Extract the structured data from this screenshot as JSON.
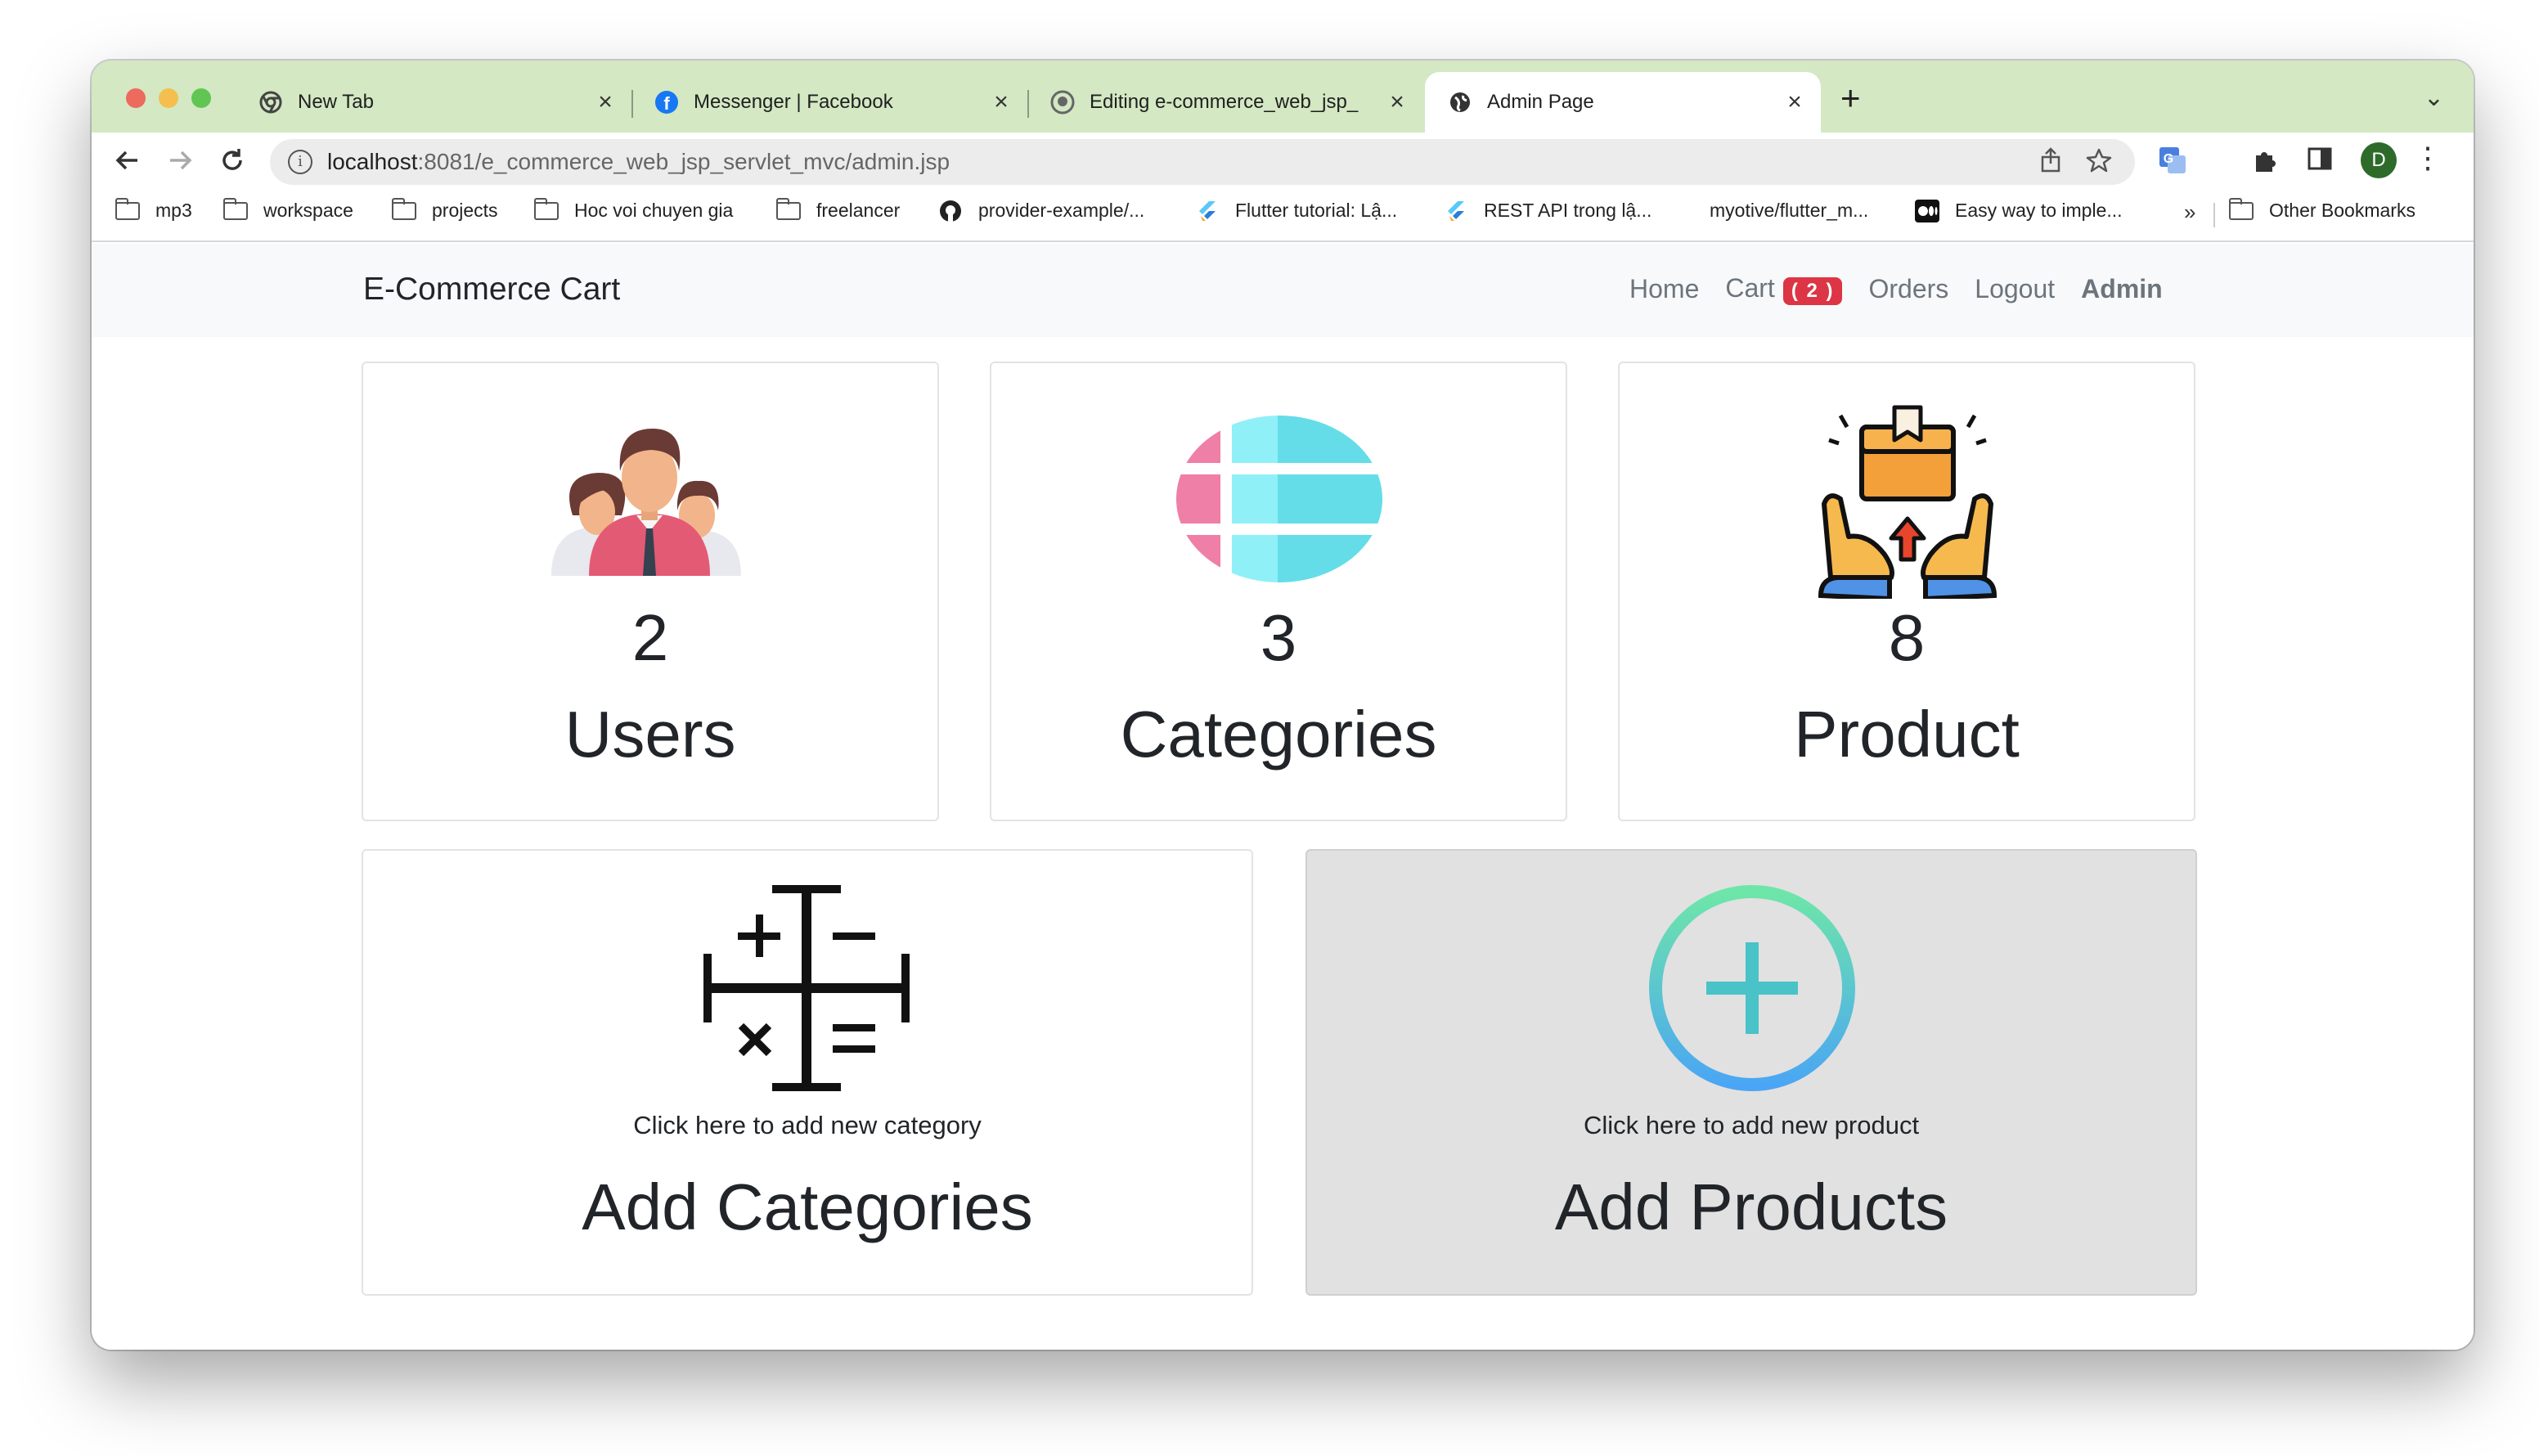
{
  "browser": {
    "tabs": [
      {
        "title": "New Tab",
        "icon": "chrome-icon"
      },
      {
        "title": "Messenger | Facebook",
        "icon": "facebook-icon"
      },
      {
        "title": "Editing e-commerce_web_jsp_",
        "icon": "github-icon"
      },
      {
        "title": "Admin Page",
        "icon": "globe-icon"
      }
    ],
    "url_host": "localhost",
    "url_path": ":8081/e_commerce_web_jsp_servlet_mvc/admin.jsp",
    "profile_initial": "D",
    "bookmarks": [
      {
        "label": "mp3",
        "icon": "folder-icon"
      },
      {
        "label": "workspace",
        "icon": "folder-icon"
      },
      {
        "label": "projects",
        "icon": "folder-icon"
      },
      {
        "label": "Hoc voi chuyen gia",
        "icon": "folder-icon"
      },
      {
        "label": "freelancer",
        "icon": "folder-icon"
      },
      {
        "label": "provider-example/...",
        "icon": "github-icon"
      },
      {
        "label": "Flutter tutorial: Lậ...",
        "icon": "flutter-icon"
      },
      {
        "label": "REST API trong lậ...",
        "icon": "flutter-icon"
      },
      {
        "label": "myotive/flutter_m...",
        "icon": "none"
      },
      {
        "label": "Easy way to imple...",
        "icon": "medium-icon"
      }
    ],
    "bookmarks_overflow": "»",
    "other_bookmarks": "Other Bookmarks"
  },
  "navbar": {
    "brand": "E-Commerce Cart",
    "links": {
      "home": "Home",
      "cart": "Cart",
      "cart_count": "( 2 )",
      "orders": "Orders",
      "logout": "Logout",
      "admin": "Admin"
    }
  },
  "stats": [
    {
      "count": "2",
      "label": "Users",
      "icon": "users-icon"
    },
    {
      "count": "3",
      "label": "Categories",
      "icon": "list-icon"
    },
    {
      "count": "8",
      "label": "Product",
      "icon": "product-box-icon"
    }
  ],
  "actions": [
    {
      "hint": "Click here to add new category",
      "label": "Add Categories",
      "icon": "calculator-icon"
    },
    {
      "hint": "Click here to add new product",
      "label": "Add Products",
      "icon": "plus-circle-icon"
    }
  ],
  "colors": {
    "badge": "#dc3545",
    "tabstrip": "#d3e8c3",
    "navbar": "#f8f9fa"
  }
}
